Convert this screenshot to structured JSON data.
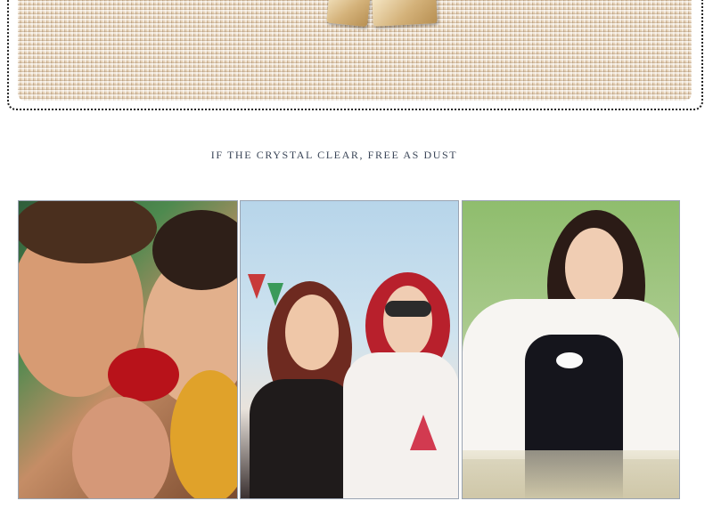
{
  "tagline": "IF THE CRYSTAL CLEAR, FREE AS DUST",
  "photos": [
    {
      "description": "couple-with-rose-photo"
    },
    {
      "description": "two-women-bunting-photo"
    },
    {
      "description": "woman-grass-field-photo"
    }
  ]
}
